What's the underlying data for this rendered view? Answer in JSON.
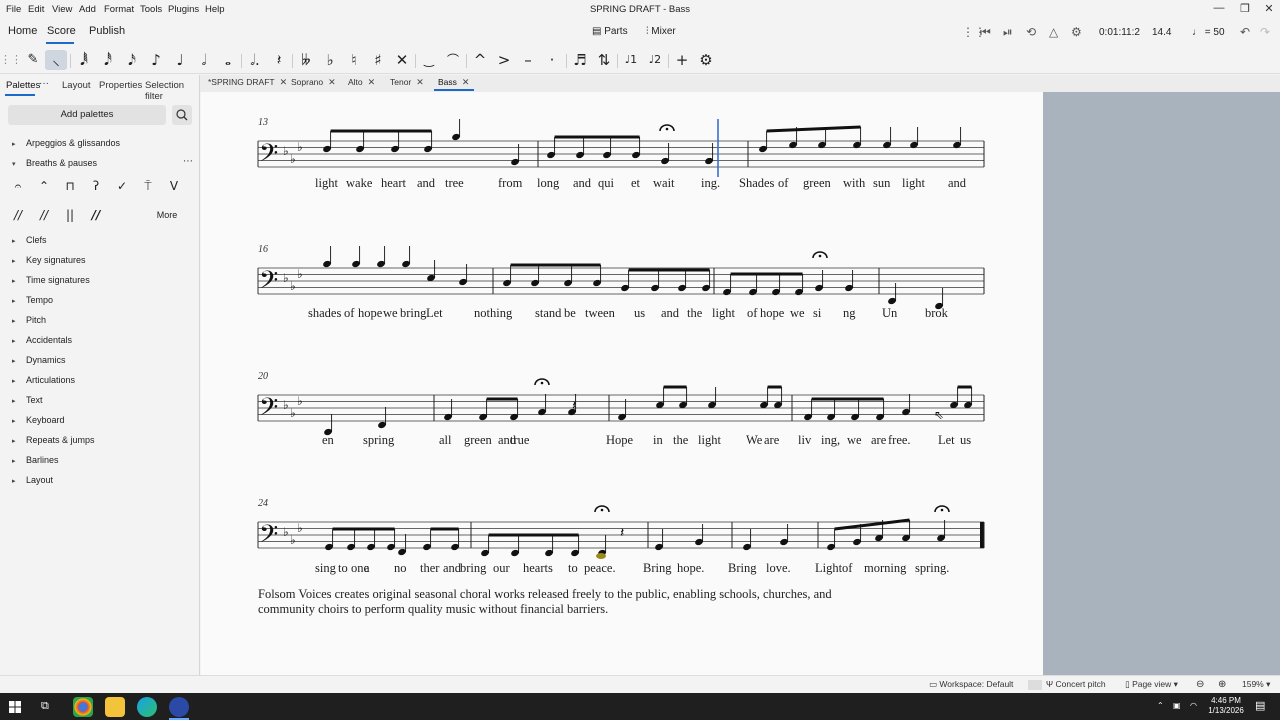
{
  "titlebar": {
    "window_title": "SPRING DRAFT - Bass",
    "menus": [
      "File",
      "Edit",
      "View",
      "Add",
      "Format",
      "Tools",
      "Plugins",
      "Help"
    ],
    "minimize": "—",
    "restore": "❐",
    "close": "✕"
  },
  "header": {
    "tabs": [
      "Home",
      "Score",
      "Publish"
    ],
    "active_tab": "Score",
    "parts_label": "Parts",
    "mixer_label": "Mixer",
    "time_display": "0:01:11:2",
    "position_display": "14.4",
    "tempo_display": "= 50"
  },
  "toolbar": {
    "tools": [
      "pen",
      "note-input",
      "64th",
      "32nd",
      "16th",
      "8th",
      "quarter",
      "half",
      "whole",
      "augmentation-dot",
      "rest",
      "double-flat",
      "flat",
      "natural",
      "sharp",
      "double-sharp",
      "tie",
      "slur",
      "marcato",
      "accent",
      "tenuto",
      "staccato",
      "tuplet",
      "flip",
      "voice-1",
      "voice-2",
      "add",
      "customize"
    ]
  },
  "left_panel": {
    "tabs": [
      "Palettes",
      "Layout",
      "Properties",
      "Selection filter"
    ],
    "active_tab": "Palettes",
    "tab_menu": "···",
    "add_palettes": "Add palettes",
    "palettes": [
      "Arpeggios & glissandos",
      "Breaths & pauses",
      "Clefs",
      "Key signatures",
      "Time signatures",
      "Tempo",
      "Pitch",
      "Accidentals",
      "Dynamics",
      "Articulations",
      "Text",
      "Keyboard",
      "Repeats & jumps",
      "Barlines",
      "Layout"
    ],
    "expanded": "Breaths & pauses",
    "more_label": "More"
  },
  "doc_tabs": [
    {
      "label": "*SPRING DRAFT"
    },
    {
      "label": "Soprano"
    },
    {
      "label": "Alto"
    },
    {
      "label": "Tenor"
    },
    {
      "label": "Bass"
    }
  ],
  "active_doc_tab": "Bass",
  "score": {
    "systems": [
      {
        "measure_number": "13",
        "lyrics": [
          "light",
          "wake",
          "heart",
          "and",
          "tree",
          "from",
          "long",
          "and",
          "qui",
          "et",
          "wait",
          "ing.",
          "Shades",
          "of",
          "green",
          "with",
          "sun",
          "light",
          "and"
        ]
      },
      {
        "measure_number": "16",
        "lyrics": [
          "shades",
          "of",
          "hope",
          "we",
          "bring",
          "Let",
          "nothing",
          "stand",
          "be",
          "tween",
          "us",
          "and",
          "the",
          "light",
          "of",
          "hope",
          "we",
          "si",
          "ng",
          "Un",
          "brok"
        ]
      },
      {
        "measure_number": "20",
        "lyrics": [
          "en",
          "spring",
          "all",
          "green",
          "and",
          "true",
          "Hope",
          "in",
          "the",
          "light",
          "We",
          "are",
          "liv",
          "ing,",
          "we",
          "are",
          "free.",
          "Let",
          "us"
        ]
      },
      {
        "measure_number": "24",
        "lyrics": [
          "sing",
          "to",
          "one",
          "a",
          "no",
          "ther",
          "and",
          "bring",
          "our",
          "hearts",
          "to",
          "peace.",
          "Bring",
          "hope.",
          "Bring",
          "love.",
          "Light",
          "of",
          "morning",
          "spring."
        ]
      }
    ],
    "footer": "Folsom Voices creates original seasonal choral works released freely to the public, enabling schools, churches, and community choirs to perform quality music without financial barriers."
  },
  "statusbar": {
    "workspace": "Workspace: Default",
    "concert_pitch": "Concert pitch",
    "view_mode": "Page view",
    "zoom": "159%"
  },
  "taskbar": {
    "time": "4:46 PM",
    "date": "1/13/2026"
  }
}
